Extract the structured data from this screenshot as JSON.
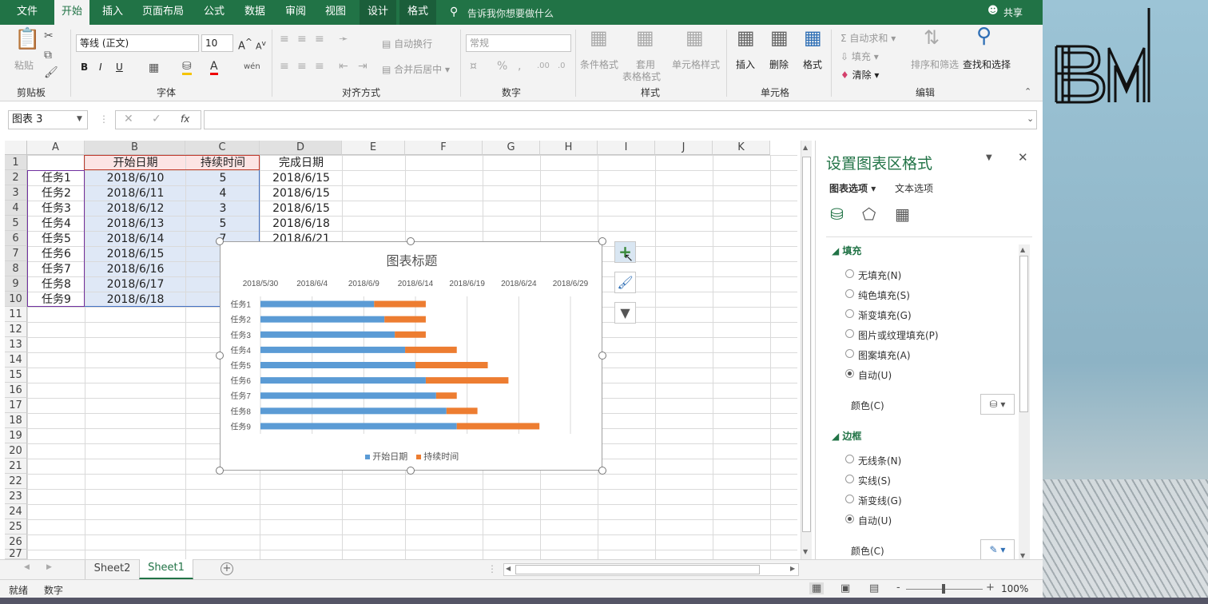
{
  "ribbon_tabs": [
    "文件",
    "开始",
    "插入",
    "页面布局",
    "公式",
    "数据",
    "审阅",
    "视图",
    "设计",
    "格式"
  ],
  "tell_me": "告诉我你想要做什么",
  "share": "共享",
  "clipboard": {
    "paste": "粘贴",
    "group": "剪贴板"
  },
  "font": {
    "name": "等线 (正文)",
    "size": "10",
    "group": "字体",
    "bold": "B",
    "italic": "I",
    "underline": "U"
  },
  "align": {
    "wrap": "自动换行",
    "merge": "合并后居中",
    "group": "对齐方式"
  },
  "number": {
    "format": "常规",
    "group": "数字"
  },
  "styles": {
    "cond": "条件格式",
    "table1": "套用",
    "table2": "表格格式",
    "cell": "单元格样式",
    "group": "样式"
  },
  "cells": {
    "insert": "插入",
    "delete": "删除",
    "format": "格式",
    "group": "单元格"
  },
  "edit": {
    "autosum": "自动求和",
    "fill": "填充",
    "clear": "清除",
    "sort": "排序和筛选",
    "find": "查找和选择",
    "group": "编辑"
  },
  "name_box": "图表 3",
  "fx": "fx",
  "columns": [
    "A",
    "B",
    "C",
    "D",
    "E",
    "F",
    "G",
    "H",
    "I",
    "J",
    "K"
  ],
  "rows": [
    "1",
    "2",
    "3",
    "4",
    "5",
    "6",
    "7",
    "8",
    "9",
    "10",
    "11",
    "12",
    "13",
    "14",
    "15",
    "16",
    "17",
    "18",
    "19",
    "20",
    "21",
    "22",
    "23",
    "24",
    "25",
    "26",
    "27"
  ],
  "table": {
    "headers": [
      "开始日期",
      "持续时间",
      "完成日期"
    ],
    "rows": [
      [
        "任务1",
        "2018/6/10",
        "5",
        "2018/6/15"
      ],
      [
        "任务2",
        "2018/6/11",
        "4",
        "2018/6/15"
      ],
      [
        "任务3",
        "2018/6/12",
        "3",
        "2018/6/15"
      ],
      [
        "任务4",
        "2018/6/13",
        "5",
        "2018/6/18"
      ],
      [
        "任务5",
        "2018/6/14",
        "7",
        "2018/6/21"
      ],
      [
        "任务6",
        "2018/6/15",
        "",
        "",
        ""
      ],
      [
        "任务7",
        "2018/6/16",
        "",
        ""
      ],
      [
        "任务8",
        "2018/6/17",
        "",
        ""
      ],
      [
        "任务9",
        "2018/6/18",
        "",
        ""
      ]
    ]
  },
  "chart_data": {
    "type": "bar",
    "title": "图表标题",
    "stacked": true,
    "categories": [
      "任务1",
      "任务2",
      "任务3",
      "任务4",
      "任务5",
      "任务6",
      "任务7",
      "任务8",
      "任务9"
    ],
    "series": [
      {
        "name": "开始日期",
        "color": "#5b9bd5",
        "values": [
          "2018/6/10",
          "2018/6/11",
          "2018/6/12",
          "2018/6/13",
          "2018/6/14",
          "2018/6/15",
          "2018/6/16",
          "2018/6/17",
          "2018/6/18"
        ]
      },
      {
        "name": "持续时间",
        "color": "#ed7d31",
        "values": [
          5,
          4,
          3,
          5,
          7,
          8,
          2,
          3,
          8
        ]
      }
    ],
    "xticks": [
      "2018/5/30",
      "2018/6/4",
      "2018/6/9",
      "2018/6/14",
      "2018/6/19",
      "2018/6/24",
      "2018/6/29"
    ],
    "xlim": [
      "2018/5/30",
      "2018/6/29"
    ],
    "x_axis_position": "top",
    "grid": true,
    "legend": "bottom"
  },
  "pane": {
    "title": "设置图表区格式",
    "tab1": "图表选项",
    "tab2": "文本选项",
    "fill_section": "填充",
    "fill_options": [
      "无填充(N)",
      "纯色填充(S)",
      "渐变填充(G)",
      "图片或纹理填充(P)",
      "图案填充(A)",
      "自动(U)"
    ],
    "color_label": "颜色(C)",
    "border_section": "边框",
    "border_options": [
      "无线条(N)",
      "实线(S)",
      "渐变线(G)",
      "自动(U)"
    ],
    "border_color_label": "颜色(C)"
  },
  "sheets": [
    "Sheet2",
    "Sheet1"
  ],
  "status": {
    "ready": "就绪",
    "mode": "数字",
    "zoom": "100%"
  },
  "watermark": "BM"
}
